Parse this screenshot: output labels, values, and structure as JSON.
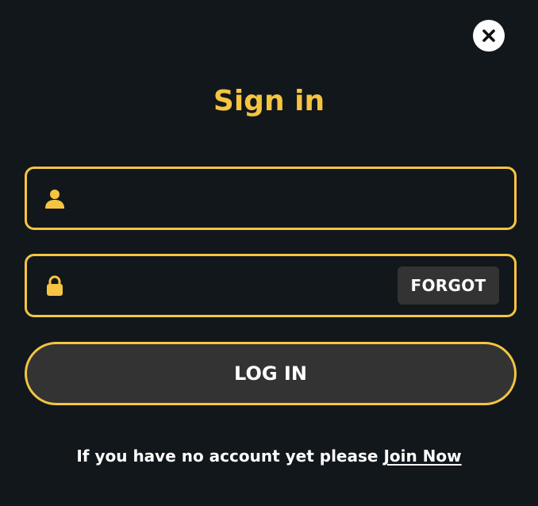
{
  "modal": {
    "title": "Sign in",
    "colors": {
      "accent": "#f5c542",
      "background": "#12171c",
      "button_bg": "#333333",
      "text": "#ffffff"
    }
  },
  "close": {
    "icon": "close-icon"
  },
  "username": {
    "icon": "user-icon",
    "value": "",
    "placeholder": ""
  },
  "password": {
    "icon": "lock-icon",
    "value": "",
    "placeholder": "",
    "forgot_label": "FORGOT"
  },
  "login": {
    "label": "LOG IN"
  },
  "footer": {
    "prompt": "If you have no account yet please",
    "join_label": "Join Now"
  }
}
